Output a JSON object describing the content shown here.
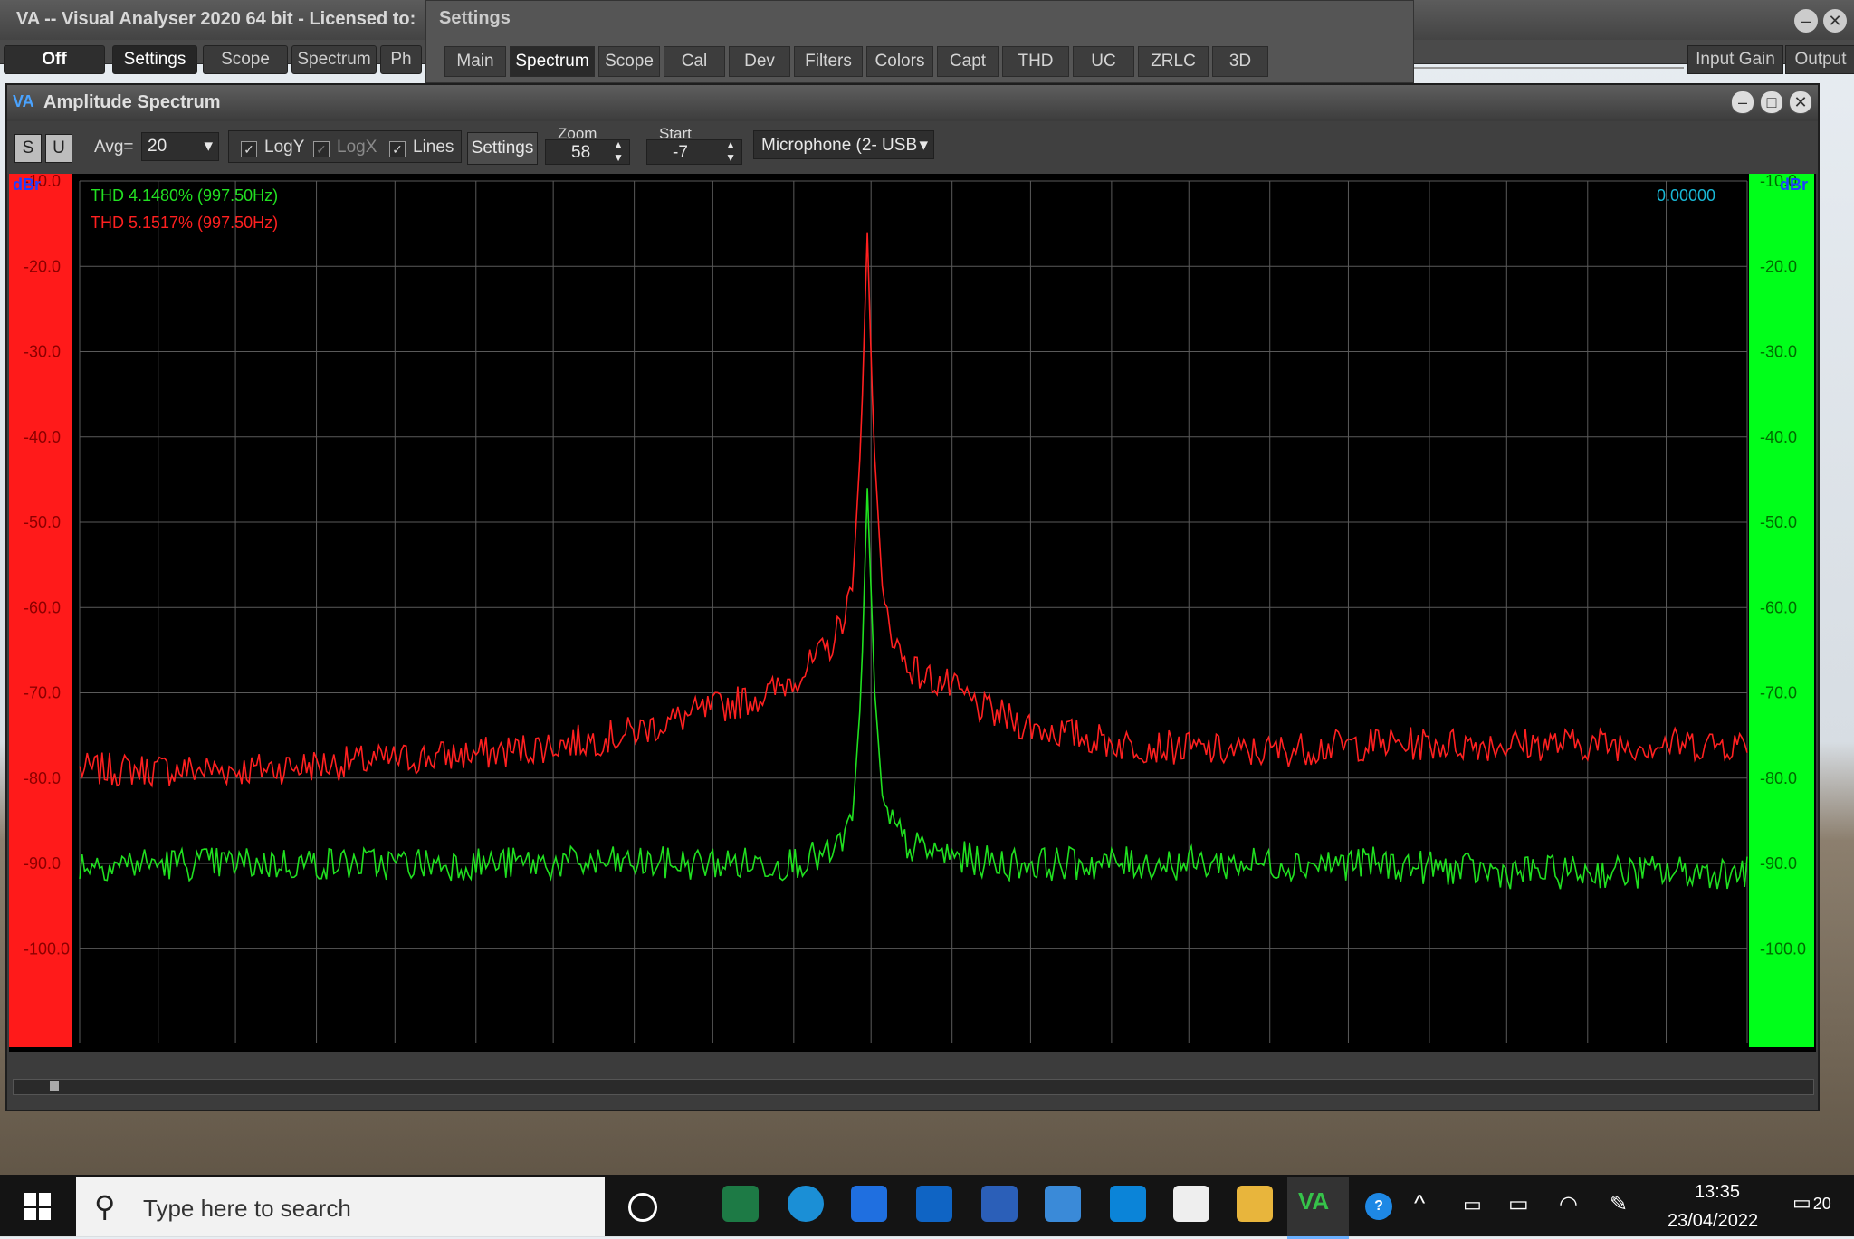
{
  "main_window": {
    "title": "VA -- Visual Analyser 2020 64 bit - Licensed to:",
    "off_label": "Off",
    "settings_label": "Settings",
    "scope_label": "Scope",
    "spectrum_label": "Spectrum",
    "phase_label": "Ph",
    "input_gain_label": "Input Gain",
    "output_label": "Output"
  },
  "settings_window": {
    "title": "Settings",
    "tabs": [
      "Main",
      "Spectrum",
      "Scope",
      "Cal",
      "Dev",
      "Filters",
      "Colors",
      "Capt",
      "THD",
      "UC",
      "ZRLC",
      "3D"
    ],
    "active_tab": "Spectrum"
  },
  "spectrum_window": {
    "title": "Amplitude Spectrum",
    "toolbar": {
      "s_label": "S",
      "u_label": "U",
      "avg_label": "Avg=",
      "avg_value": "20",
      "logy_label": "LogY",
      "logx_label": "LogX",
      "lines_label": "Lines",
      "settings_label": "Settings",
      "zoom_label": "Zoom",
      "zoom_value": "58",
      "start_label": "Start",
      "start_value": "-7",
      "device_value": "Microphone (2- USB"
    }
  },
  "chart_data": {
    "type": "line",
    "left_unit": "dBr",
    "right_unit": "dBr",
    "x_unit": "Hz",
    "readout": "0.00000",
    "thd_green": "THD 4.1480% (997.50Hz)",
    "thd_red": "THD 5.1517% (997.50Hz)",
    "y_ticks": [
      "-10.0",
      "-20.0",
      "-30.0",
      "-40.0",
      "-50.0",
      "-60.0",
      "-70.0",
      "-80.0",
      "-90.0",
      "-100.0"
    ],
    "ylim": [
      -111,
      -10
    ],
    "x_ticks": [
      "365",
      "428",
      "490",
      "555",
      "618",
      "683",
      "745",
      "810",
      "873",
      "938",
      "1000",
      "1065",
      "1128",
      "1193",
      "1255",
      "1320",
      "1383",
      "1448",
      "1510",
      "1575",
      "1638",
      "1703"
    ],
    "xlim": [
      365,
      1703
    ],
    "series": [
      {
        "color": "#ff2020",
        "points": [
          [
            365,
            -79
          ],
          [
            500,
            -79
          ],
          [
            600,
            -78
          ],
          [
            700,
            -77
          ],
          [
            800,
            -75
          ],
          [
            870,
            -72
          ],
          [
            920,
            -70
          ],
          [
            950,
            -67
          ],
          [
            970,
            -64
          ],
          [
            985,
            -58
          ],
          [
            992,
            -40
          ],
          [
            997,
            -16
          ],
          [
            1002,
            -40
          ],
          [
            1010,
            -60
          ],
          [
            1025,
            -66
          ],
          [
            1040,
            -68
          ],
          [
            1060,
            -69
          ],
          [
            1090,
            -72
          ],
          [
            1130,
            -74
          ],
          [
            1200,
            -76
          ],
          [
            1300,
            -77
          ],
          [
            1400,
            -76
          ],
          [
            1500,
            -76
          ],
          [
            1600,
            -76
          ],
          [
            1703,
            -76
          ]
        ]
      },
      {
        "color": "#20e020",
        "points": [
          [
            365,
            -90
          ],
          [
            500,
            -90
          ],
          [
            600,
            -90
          ],
          [
            700,
            -90
          ],
          [
            800,
            -90
          ],
          [
            870,
            -90
          ],
          [
            930,
            -90
          ],
          [
            970,
            -89
          ],
          [
            985,
            -85
          ],
          [
            992,
            -70
          ],
          [
            997,
            -46
          ],
          [
            1003,
            -70
          ],
          [
            1010,
            -84
          ],
          [
            1030,
            -88
          ],
          [
            1060,
            -89
          ],
          [
            1100,
            -90
          ],
          [
            1200,
            -90
          ],
          [
            1300,
            -90
          ],
          [
            1400,
            -90
          ],
          [
            1500,
            -91
          ],
          [
            1600,
            -91
          ],
          [
            1703,
            -91
          ]
        ]
      }
    ]
  },
  "taskbar": {
    "search_placeholder": "Type here to search",
    "time": "13:35",
    "date": "23/04/2022",
    "notification_count": "20"
  }
}
